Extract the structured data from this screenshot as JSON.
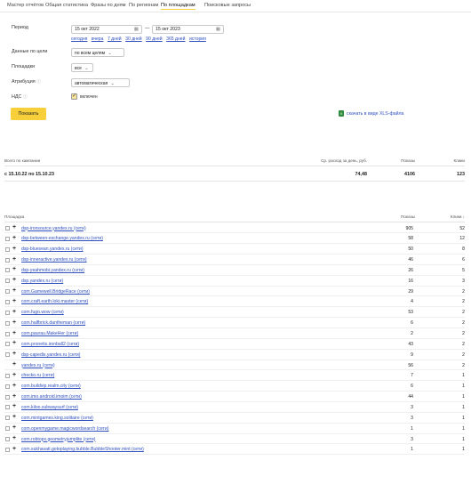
{
  "tabs": [
    "Мастер отчётов",
    "Общая статистика",
    "Фразы по дням",
    "По регионам",
    "По площадкам",
    "Поисковые запросы"
  ],
  "active_tab": "По площадкам",
  "filters": {
    "period_label": "Период",
    "date_from": "15 окт 2022",
    "date_to": "15 окт 2023",
    "date_dash": "—",
    "quick_links": [
      "сегодня",
      "вчера",
      "7 дней",
      "30 дней",
      "90 дней",
      "365 дней",
      "история"
    ],
    "goal_label": "Данные по цели",
    "goal_value": "по всем целям",
    "sites_label": "Площадки",
    "sites_value": "все",
    "attribution_label": "Атрибуция",
    "attribution_value": "автоматическая",
    "vat_label": "НДС",
    "vat_value": "включен",
    "show_button": "Показать",
    "xls_link": "скачать в виде XLS-файла"
  },
  "summary": {
    "headers": {
      "campaigns": "Всего по кампании",
      "spend": "Ср. расход за день, руб.",
      "shows": "Показы",
      "clicks": "Клики"
    },
    "period": "с 15.10.22 по 15.10.23",
    "spend": "74,48",
    "shows": "4106",
    "clicks": "123"
  },
  "table": {
    "headers": {
      "site": "Площадка",
      "shows": "Показы",
      "clicks": "Клики ↓"
    },
    "rows": [
      {
        "name": "dsp-ironsource.yandex.ru (сети)",
        "shows": "905",
        "clicks": "52",
        "checkbox": true
      },
      {
        "name": "dsp-between-exchange.yandex.ru (сети)",
        "shows": "58",
        "clicks": "12",
        "checkbox": true
      },
      {
        "name": "dsp-bluesean.yandex.ru (сети)",
        "shows": "50",
        "clicks": "8",
        "checkbox": true
      },
      {
        "name": "dsp-inneractive.yandex.ru (сети)",
        "shows": "46",
        "clicks": "6",
        "checkbox": true
      },
      {
        "name": "dsp-yeahmobi.yandex.ru (сети)",
        "shows": "26",
        "clicks": "5",
        "checkbox": true
      },
      {
        "name": "dsp.yandex.ru (сети)",
        "shows": "16",
        "clicks": "3",
        "checkbox": true
      },
      {
        "name": "com.Gamewell.BridgeRace (сети)",
        "shows": "29",
        "clicks": "2",
        "checkbox": true
      },
      {
        "name": "com.craft.earth.loki.master (сети)",
        "shows": "4",
        "clicks": "2",
        "checkbox": true
      },
      {
        "name": "com.fugo.wow (сети)",
        "shows": "53",
        "clicks": "2",
        "checkbox": true
      },
      {
        "name": "com.halfbrick.dantheman (сети)",
        "shows": "6",
        "clicks": "2",
        "checkbox": true
      },
      {
        "name": "com.paurau.MakeHer (сети)",
        "shows": "2",
        "clicks": "2",
        "checkbox": true
      },
      {
        "name": "com.pronetis.ironball2 (сети)",
        "shows": "43",
        "clicks": "2",
        "checkbox": true
      },
      {
        "name": "dsp-capedis.yandex.ru (сети)",
        "shows": "9",
        "clicks": "2",
        "checkbox": true
      },
      {
        "name": "yandex.ru (сети)",
        "shows": "56",
        "clicks": "2",
        "checkbox": false
      },
      {
        "name": "checko.ru (сети)",
        "shows": "7",
        "clicks": "1",
        "checkbox": true
      },
      {
        "name": "com.buildvip.realm.city (сети)",
        "shows": "6",
        "clicks": "1",
        "checkbox": true
      },
      {
        "name": "com.imo.android.imoim (сети)",
        "shows": "44",
        "clicks": "1",
        "checkbox": true
      },
      {
        "name": "com.kiloo.subwaysurf (сети)",
        "shows": "3",
        "clicks": "1",
        "checkbox": true
      },
      {
        "name": "com.mintgames.king.solitaire (сети)",
        "shows": "3",
        "clicks": "1",
        "checkbox": true
      },
      {
        "name": "com.openmygame.magicwordsearch (сети)",
        "shows": "1",
        "clicks": "1",
        "checkbox": true
      },
      {
        "name": "com.robtopx.geometryjumplite (сети)",
        "shows": "3",
        "clicks": "1",
        "checkbox": true
      },
      {
        "name": "com.sukhavati.gotoplaying.bubble.BubbleShooter.mint (сети)",
        "shows": "1",
        "clicks": "1",
        "checkbox": true
      }
    ]
  }
}
